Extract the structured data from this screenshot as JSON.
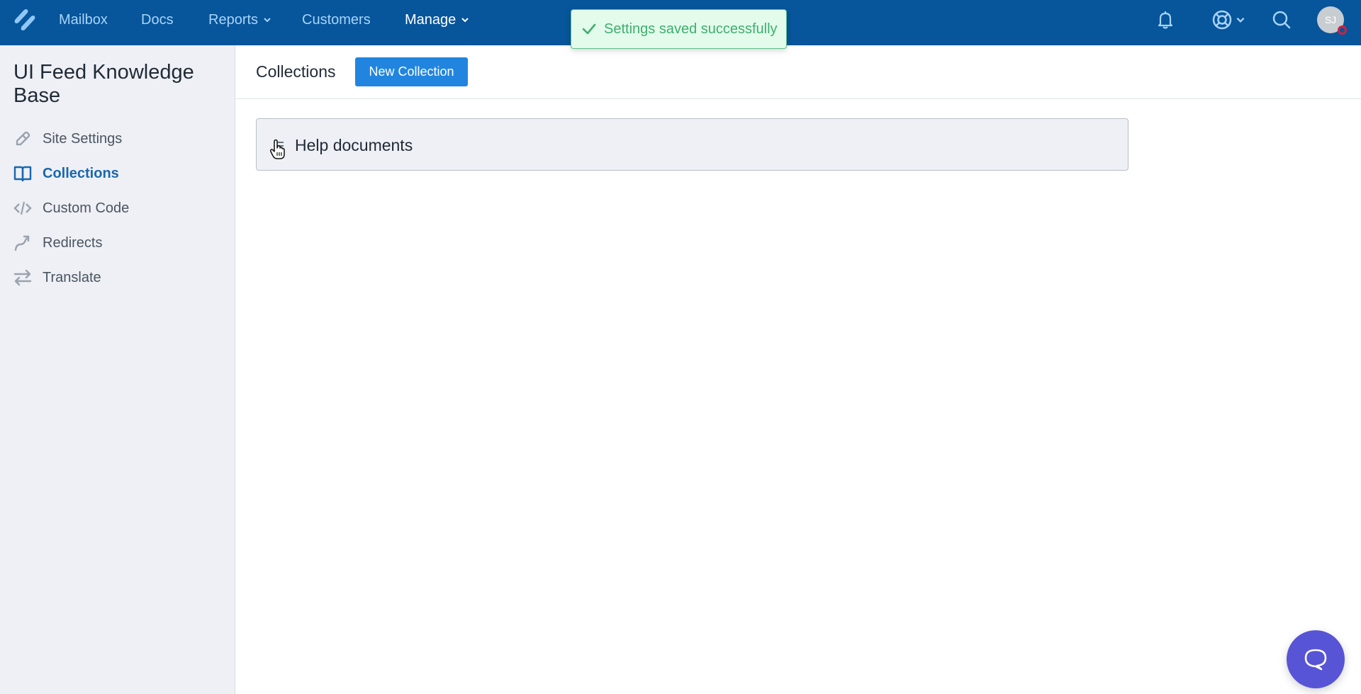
{
  "topnav": {
    "logo": "helpscout-logo-icon",
    "items": [
      {
        "label": "Mailbox",
        "dropdown": false,
        "active": false
      },
      {
        "label": "Docs",
        "dropdown": false,
        "active": false
      },
      {
        "label": "Reports",
        "dropdown": true,
        "active": false
      },
      {
        "label": "Customers",
        "dropdown": false,
        "active": false
      },
      {
        "label": "Manage",
        "dropdown": true,
        "active": true
      }
    ],
    "right_icons": [
      "bell-icon",
      "lifebuoy-icon",
      "search-icon"
    ],
    "avatar_initials": "SJ",
    "colors": {
      "bar": "#07559a",
      "item": "#a7d4fb",
      "active_item": "#ffffff"
    }
  },
  "toast": {
    "icon": "check-icon",
    "message": "Settings saved successfully",
    "colors": {
      "bg": "#e3fbeb",
      "text": "#3fae6f"
    }
  },
  "sidebar": {
    "title": "UI Feed Knowledge Base",
    "items": [
      {
        "label": "Site Settings",
        "icon": "pencil-icon",
        "active": false
      },
      {
        "label": "Collections",
        "icon": "book-icon",
        "active": true
      },
      {
        "label": "Custom Code",
        "icon": "code-icon",
        "active": false
      },
      {
        "label": "Redirects",
        "icon": "redirect-arrow-icon",
        "active": false
      },
      {
        "label": "Translate",
        "icon": "swap-arrows-icon",
        "active": false
      }
    ],
    "colors": {
      "active": "#1a67ae"
    }
  },
  "main": {
    "title": "Collections",
    "new_button_label": "New Collection",
    "collections": [
      {
        "name": "Help documents"
      }
    ]
  },
  "beacon": {
    "icon": "chat-bubble-icon",
    "color": "#5754d6"
  }
}
